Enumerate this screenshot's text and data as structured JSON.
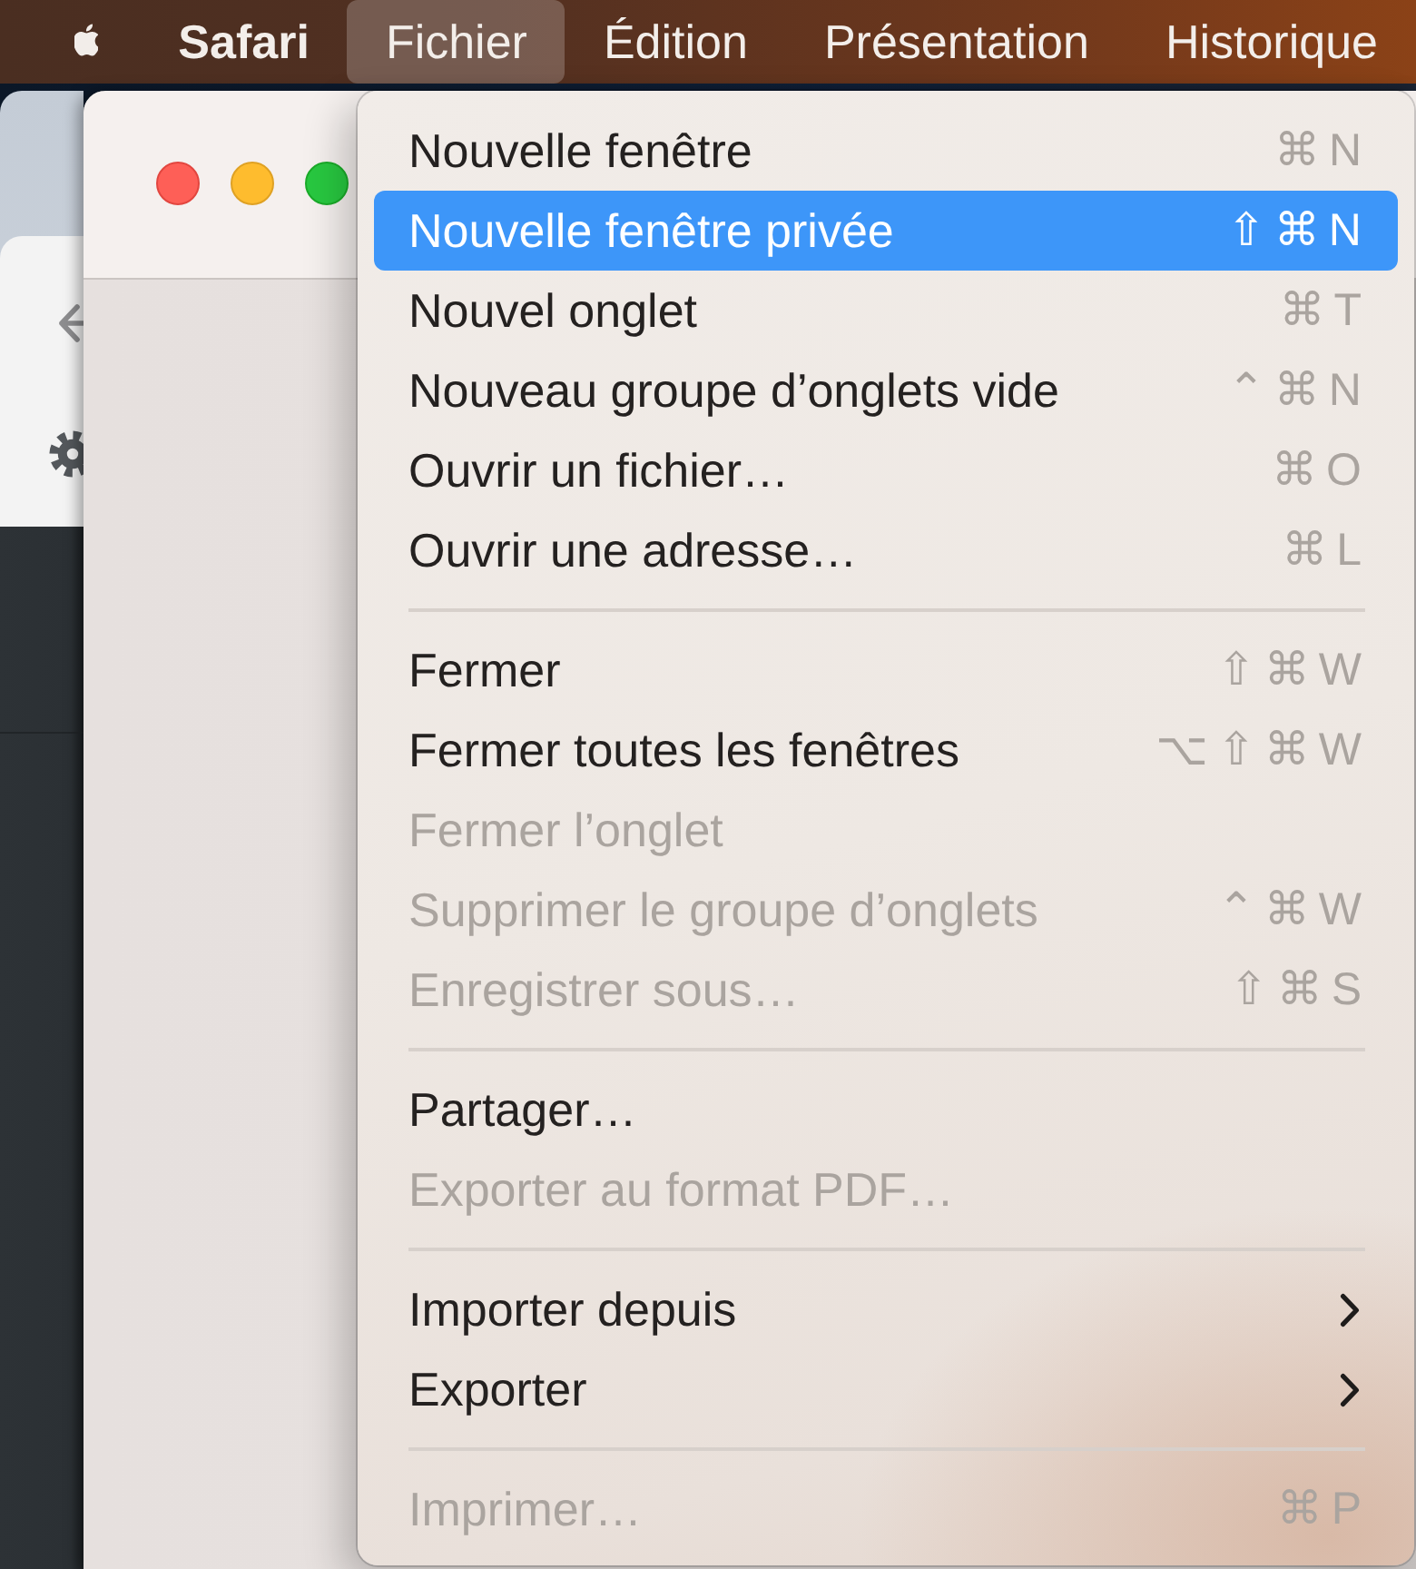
{
  "menu_bar": {
    "items": [
      {
        "label": "Safari",
        "kind": "app",
        "selected": false
      },
      {
        "label": "Fichier",
        "kind": "menu",
        "selected": true
      },
      {
        "label": "Édition",
        "kind": "menu",
        "selected": false
      },
      {
        "label": "Présentation",
        "kind": "menu",
        "selected": false
      },
      {
        "label": "Historique",
        "kind": "menu",
        "selected": false
      }
    ]
  },
  "menu": {
    "sections": [
      {
        "items": [
          {
            "label": "Nouvelle fenêtre",
            "kind": "command",
            "shortcut": "⌘N",
            "selected": false,
            "disabled": false
          },
          {
            "label": "Nouvelle fenêtre privée",
            "kind": "command",
            "shortcut": "⇧⌘N",
            "selected": true,
            "disabled": false
          },
          {
            "label": "Nouvel onglet",
            "kind": "command",
            "shortcut": "⌘T",
            "selected": false,
            "disabled": false
          },
          {
            "label": "Nouveau groupe d’onglets vide",
            "kind": "command",
            "shortcut": "⌃⌘N",
            "selected": false,
            "disabled": false
          },
          {
            "label": "Ouvrir un fichier…",
            "kind": "command",
            "shortcut": "⌘O",
            "selected": false,
            "disabled": false
          },
          {
            "label": "Ouvrir une adresse…",
            "kind": "command",
            "shortcut": "⌘L",
            "selected": false,
            "disabled": false
          }
        ]
      },
      {
        "items": [
          {
            "label": "Fermer",
            "kind": "command",
            "shortcut": "⇧⌘W",
            "selected": false,
            "disabled": false
          },
          {
            "label": "Fermer toutes les fenêtres",
            "kind": "command",
            "shortcut": "⌥⇧⌘W",
            "selected": false,
            "disabled": false
          },
          {
            "label": "Fermer l’onglet",
            "kind": "command",
            "selected": false,
            "disabled": true
          },
          {
            "label": "Supprimer le groupe d’onglets",
            "kind": "command",
            "shortcut": "⌃⌘W",
            "selected": false,
            "disabled": true
          },
          {
            "label": "Enregistrer sous…",
            "kind": "command",
            "shortcut": "⇧⌘S",
            "selected": false,
            "disabled": true
          }
        ]
      },
      {
        "items": [
          {
            "label": "Partager…",
            "kind": "command",
            "selected": false,
            "disabled": false
          },
          {
            "label": "Exporter au format PDF…",
            "kind": "command",
            "selected": false,
            "disabled": true
          }
        ]
      },
      {
        "items": [
          {
            "label": "Importer depuis",
            "kind": "submenu",
            "selected": false,
            "disabled": false
          },
          {
            "label": "Exporter",
            "kind": "submenu",
            "selected": false,
            "disabled": false
          }
        ]
      },
      {
        "items": [
          {
            "label": "Imprimer…",
            "kind": "command",
            "shortcut": "⌘P",
            "selected": false,
            "disabled": true
          }
        ]
      }
    ]
  }
}
